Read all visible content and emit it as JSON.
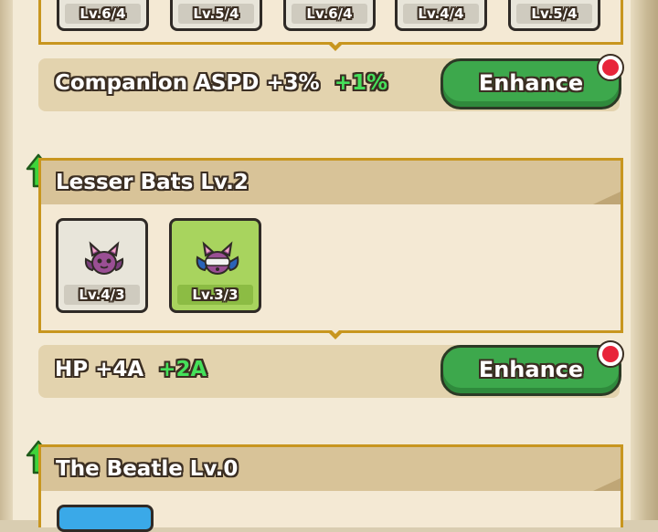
{
  "top_row": {
    "levels": [
      "Lv.6/4",
      "Lv.5/4",
      "Lv.6/4",
      "Lv.4/4",
      "Lv.5/4"
    ]
  },
  "stat1": {
    "label": "Companion ASPD +3%",
    "bonus": "+1%",
    "button": "Enhance"
  },
  "group1": {
    "title": "Lesser Bats Lv.2",
    "cards": [
      {
        "level": "Lv.4/3",
        "icon": "purple-bat-icon"
      },
      {
        "level": "Lv.3/3",
        "icon": "bandaged-bat-icon"
      }
    ]
  },
  "stat2": {
    "label": "HP +4A",
    "bonus": "+2A",
    "button": "Enhance"
  },
  "group2": {
    "title": "The Beatle Lv.0"
  },
  "colors": {
    "accent_gold": "#c8961f",
    "enhance_green": "#3da84c",
    "bonus_green": "#45e05a",
    "alert_red": "#e8243a"
  }
}
